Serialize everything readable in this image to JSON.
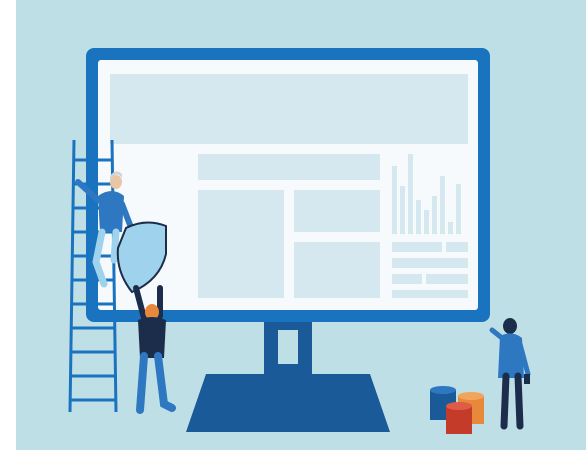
{
  "illustration": {
    "subject": "",
    "colors": {
      "background": "#bfdfe6",
      "monitor_frame": "#1a73bf",
      "monitor_stand": "#1a5a98",
      "screen": "#f7fafc",
      "screen_blocks": "#d6e8ef",
      "accent_orange": "#e8883a",
      "accent_red": "#c43b2a",
      "dark_navy": "#1b2d4a"
    },
    "icons": [
      "ladder-icon",
      "shield-icon",
      "paint-bucket-icon"
    ]
  }
}
